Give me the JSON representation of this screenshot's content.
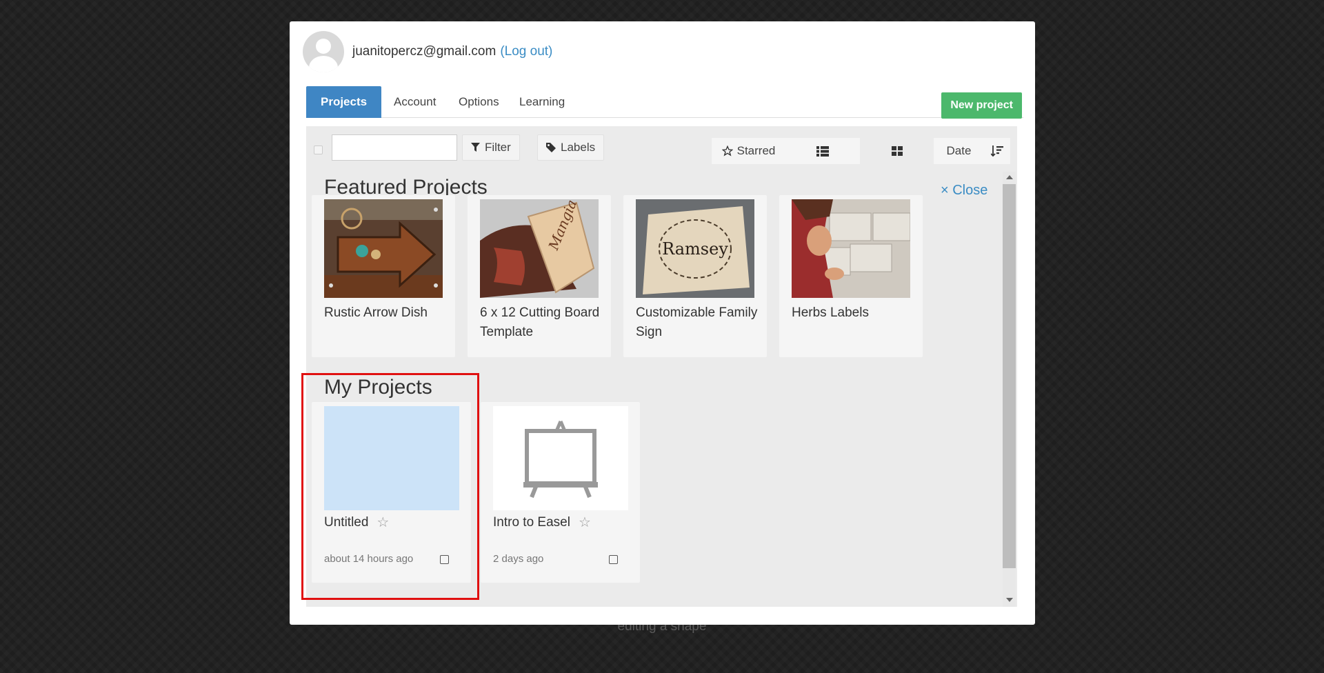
{
  "background": {
    "caption": "editing a shape"
  },
  "user": {
    "email": "juanitopercz@gmail.com",
    "logout_label": "(Log out)"
  },
  "tabs": [
    {
      "label": "Projects",
      "active": true
    },
    {
      "label": "Account"
    },
    {
      "label": "Options"
    },
    {
      "label": "Learning"
    }
  ],
  "new_project_label": "New project",
  "toolbar": {
    "search": {
      "value": "",
      "placeholder": ""
    },
    "filter_label": "Filter",
    "labels_label": "Labels",
    "starred_label": "Starred",
    "sort_label": "Date"
  },
  "featured": {
    "title": "Featured Projects",
    "close_label": "× Close",
    "items": [
      {
        "name": "Rustic Arrow Dish"
      },
      {
        "name": "6 x 12 Cutting Board Template",
        "thumb_text": "Mangia bene"
      },
      {
        "name": "Customizable Family Sign",
        "thumb_text": "Ramsey"
      },
      {
        "name": "Herbs Labels"
      }
    ]
  },
  "my_projects": {
    "title": "My Projects",
    "items": [
      {
        "name": "Untitled",
        "time": "about 14 hours ago"
      },
      {
        "name": "Intro to Easel",
        "time": "2 days ago"
      }
    ]
  },
  "colors": {
    "primary": "#3f86c4",
    "success": "#4cb86c",
    "link": "#3a8cc4",
    "highlight": "#e01010"
  }
}
